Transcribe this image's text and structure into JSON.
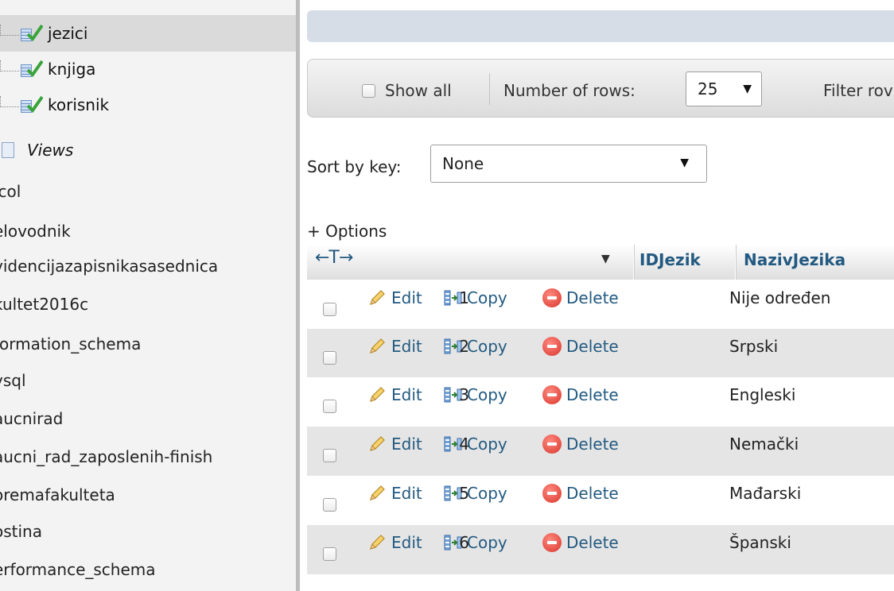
{
  "sidebar": {
    "tables": [
      {
        "label": "jezici"
      },
      {
        "label": "knjiga"
      },
      {
        "label": "korisnik"
      }
    ],
    "views_label": "Views",
    "databases": [
      "lcol",
      "elovodnik",
      "videncijazapisnikasasednica",
      "kultet2016c",
      "formation_schema",
      "ysql",
      "aucnirad",
      "aucni_rad_zaposlenih-finish",
      "oremafakulteta",
      "ostina",
      "erformance_schema"
    ]
  },
  "navigation": {
    "show_all_label": "Show all",
    "rows_label": "Number of rows:",
    "rows_value": "25",
    "filter_label": "Filter rov"
  },
  "sort": {
    "label": "Sort by key:",
    "value": "None"
  },
  "options_link": "+ Options",
  "table": {
    "col_arrows": "←T→",
    "columns": [
      "IDJezik",
      "NazivJezika"
    ],
    "actions": {
      "edit": "Edit",
      "copy": "Copy",
      "delete": "Delete"
    },
    "rows": [
      {
        "id": "1",
        "name": "Nije određen"
      },
      {
        "id": "2",
        "name": "Srpski"
      },
      {
        "id": "3",
        "name": "Engleski"
      },
      {
        "id": "4",
        "name": "Nemački"
      },
      {
        "id": "5",
        "name": "Mađarski"
      },
      {
        "id": "6",
        "name": "Španski"
      }
    ]
  },
  "colors": {
    "link": "#235a81",
    "row_alt": "#e5e5e5",
    "sidebar_bg": "#f3f3f3",
    "delete_icon": "#d8342a"
  }
}
